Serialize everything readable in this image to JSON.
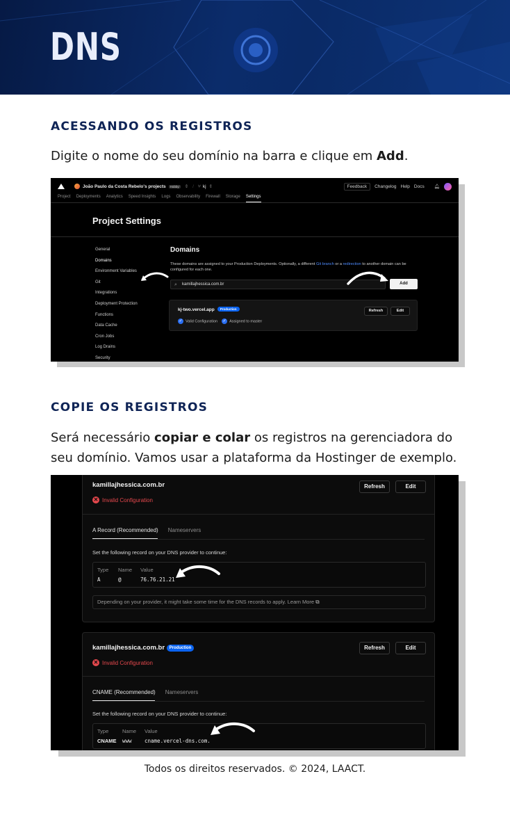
{
  "banner": {
    "title": "DNS"
  },
  "section1": {
    "heading": "ACESSANDO OS REGISTROS",
    "text_before": "Digite o nome do seu domínio na barra e clique em ",
    "text_bold": "Add",
    "text_after": "."
  },
  "section2": {
    "heading": "COPIE OS REGISTROS",
    "text_1": "Será necessário ",
    "text_bold": "copiar e colar",
    "text_2": " os registros na gerenciadora do seu domínio. Vamos usar a plataforma da Hostinger de exemplo."
  },
  "shot1": {
    "team": "João Paulo da Costa Rebelo's projects",
    "plan_badge": "Hobby",
    "project": "kj",
    "top_links": [
      "Feedback",
      "Changelog",
      "Help",
      "Docs"
    ],
    "tabs": [
      "Project",
      "Deployments",
      "Analytics",
      "Speed Insights",
      "Logs",
      "Observability",
      "Firewall",
      "Storage",
      "Settings"
    ],
    "active_tab": "Settings",
    "page_title": "Project Settings",
    "sidebar": [
      "General",
      "Domains",
      "Environment Variables",
      "Git",
      "Integrations",
      "Deployment Protection",
      "Functions",
      "Data Cache",
      "Cron Jobs",
      "Log Drains",
      "Security"
    ],
    "domains_title": "Domains",
    "desc_1": "These domains are assigned to your Production Deployments. Optionally, a different ",
    "desc_link1": "Git branch",
    "desc_2": " or a ",
    "desc_link2": "redirection",
    "desc_3": " to another domain can be configured for each one.",
    "input_value": "kamillajhessica.com.br",
    "add_label": "Add",
    "card_host": "kj-two.vercel.app",
    "card_badge": "Production",
    "check1": "Valid Configuration",
    "check2": "Assigned to master",
    "refresh_label": "Refresh",
    "edit_label": "Edit"
  },
  "shot2": {
    "card1": {
      "host": "kamillajhessica.com.br",
      "status": "Invalid Configuration",
      "refresh_label": "Refresh",
      "edit_label": "Edit",
      "tab_active": "A Record (Recommended)",
      "tab_other": "Nameservers",
      "instruction": "Set the following record on your DNS provider to continue:",
      "headers": [
        "Type",
        "Name",
        "Value"
      ],
      "row": [
        "A",
        "@",
        "76.76.21.21"
      ],
      "note": "Depending on your provider, it might take some time for the DNS records to apply. Learn More"
    },
    "card2": {
      "host": "kamillajhessica.com.br",
      "badge": "Production",
      "status": "Invalid Configuration",
      "refresh_label": "Refresh",
      "edit_label": "Edit",
      "tab_active": "CNAME (Recommended)",
      "tab_other": "Nameservers",
      "instruction": "Set the following record on your DNS provider to continue:",
      "headers": [
        "Type",
        "Name",
        "Value"
      ],
      "row": [
        "CNAME",
        "www",
        "cname.vercel-dns.com."
      ]
    }
  },
  "footer": {
    "text": "Todos os direitos reservados. © 2024, LAACT."
  }
}
